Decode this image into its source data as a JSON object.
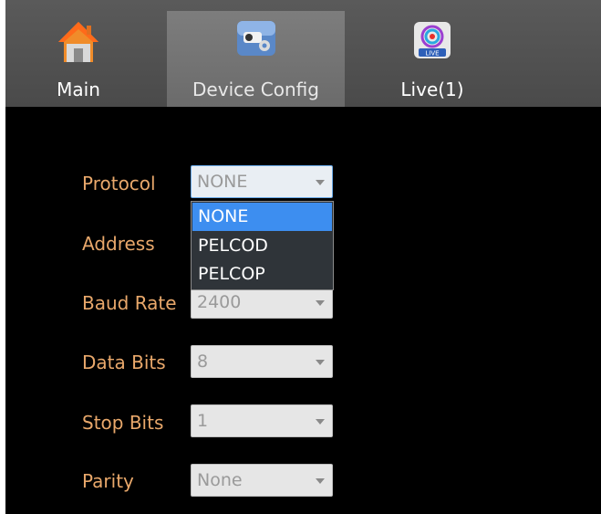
{
  "tabs": [
    {
      "label": "Main",
      "icon": "house-icon"
    },
    {
      "label": "Device Config",
      "icon": "camera-settings-icon",
      "active": true
    },
    {
      "label": "Live(1)",
      "icon": "live-icon"
    }
  ],
  "form": {
    "protocol": {
      "label": "Protocol",
      "value": "NONE"
    },
    "address": {
      "label": "Address"
    },
    "baud_rate": {
      "label": "Baud Rate",
      "value": "2400"
    },
    "data_bits": {
      "label": "Data Bits",
      "value": "8"
    },
    "stop_bits": {
      "label": "Stop Bits",
      "value": "1"
    },
    "parity": {
      "label": "Parity",
      "value": "None"
    }
  },
  "protocol_dropdown": {
    "options": [
      "NONE",
      "PELCOD",
      "PELCOP"
    ],
    "selected": "NONE"
  },
  "colors": {
    "label": "#e9a86b",
    "highlight": "#3d8ef0",
    "background": "#000000",
    "tabbar": "#505050"
  }
}
